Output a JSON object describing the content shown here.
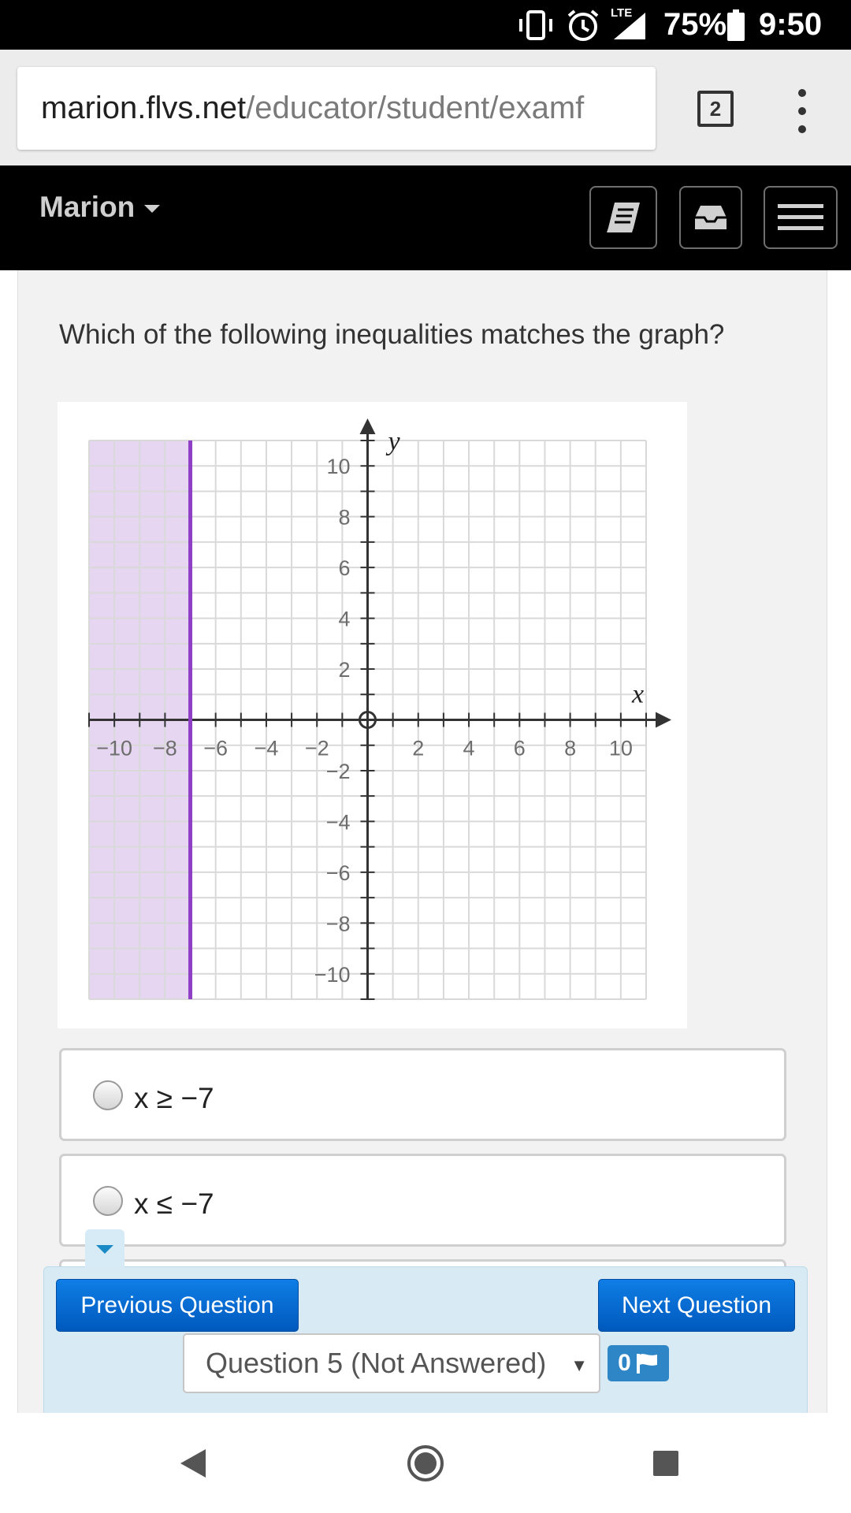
{
  "status_bar": {
    "battery_percent": "75%",
    "time": "9:50",
    "network": "LTE",
    "icons": [
      "vibrate-icon",
      "alarm-icon",
      "signal-icon",
      "battery-icon"
    ]
  },
  "browser": {
    "url_domain": "marion.flvs.net",
    "url_path": "/educator/student/examf",
    "tab_count": "2",
    "menu_icon": "more-vert-icon"
  },
  "app_header": {
    "brand": "Marion",
    "buttons": [
      "notebook-icon",
      "inbox-icon",
      "hamburger-menu-icon"
    ]
  },
  "question": {
    "prompt": "Which of the following inequalities matches the graph?",
    "options": [
      {
        "label": "x ≥ −7",
        "selected": false
      },
      {
        "label": "x ≤ −7",
        "selected": false
      }
    ]
  },
  "chart_data": {
    "type": "scatter",
    "xlabel": "x",
    "ylabel": "y",
    "xlim": [
      -11,
      11
    ],
    "ylim": [
      -11,
      11
    ],
    "grid": true,
    "x_tick_labels": [
      "−10",
      "−8",
      "−6",
      "−4",
      "−2",
      "2",
      "4",
      "6",
      "8",
      "10"
    ],
    "y_tick_labels": [
      "10",
      "8",
      "6",
      "4",
      "2",
      "−2",
      "−4",
      "−6",
      "−8",
      "−10"
    ],
    "boundary": {
      "x": -7,
      "style": "solid",
      "color": "#8e3fc6"
    },
    "shaded_region": {
      "side": "left",
      "color": "#e6d6f2"
    }
  },
  "navigation": {
    "previous_label": "Previous Question",
    "next_label": "Next Question",
    "question_select_value": "Question 5 (Not Answered)",
    "flag_count": "0"
  },
  "android_nav": [
    "back-icon",
    "home-icon",
    "recents-icon"
  ]
}
